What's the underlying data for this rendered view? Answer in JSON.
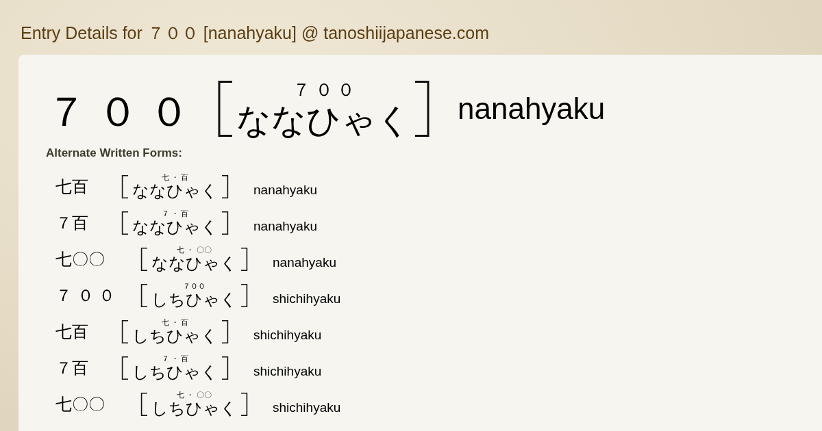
{
  "title": "Entry Details for ７００ [nanahyaku] @ tanoshiijapanese.com",
  "entry": {
    "written": "７ ０ ０",
    "furigana": "７ ０ ０",
    "kana": "ななひゃく",
    "romaji": "nanahyaku"
  },
  "alternate_heading": "Alternate Written Forms:",
  "alternates": [
    {
      "written": "七百",
      "furigana": "七 ・ 百",
      "kana": "ななひゃく",
      "romaji": "nanahyaku"
    },
    {
      "written": "７百",
      "furigana": "７ ・ 百",
      "kana": "ななひゃく",
      "romaji": "nanahyaku"
    },
    {
      "written": "七〇〇",
      "furigana": "七 ・ 〇〇",
      "kana": "ななひゃく",
      "romaji": "nanahyaku"
    },
    {
      "written": "７ ０ ０",
      "furigana": "７００",
      "kana": "しちひゃく",
      "romaji": "shichihyaku"
    },
    {
      "written": "七百",
      "furigana": "七 ・ 百",
      "kana": "しちひゃく",
      "romaji": "shichihyaku"
    },
    {
      "written": "７百",
      "furigana": "７ ・ 百",
      "kana": "しちひゃく",
      "romaji": "shichihyaku"
    },
    {
      "written": "七〇〇",
      "furigana": "七 ・ 〇〇",
      "kana": "しちひゃく",
      "romaji": "shichihyaku"
    }
  ]
}
